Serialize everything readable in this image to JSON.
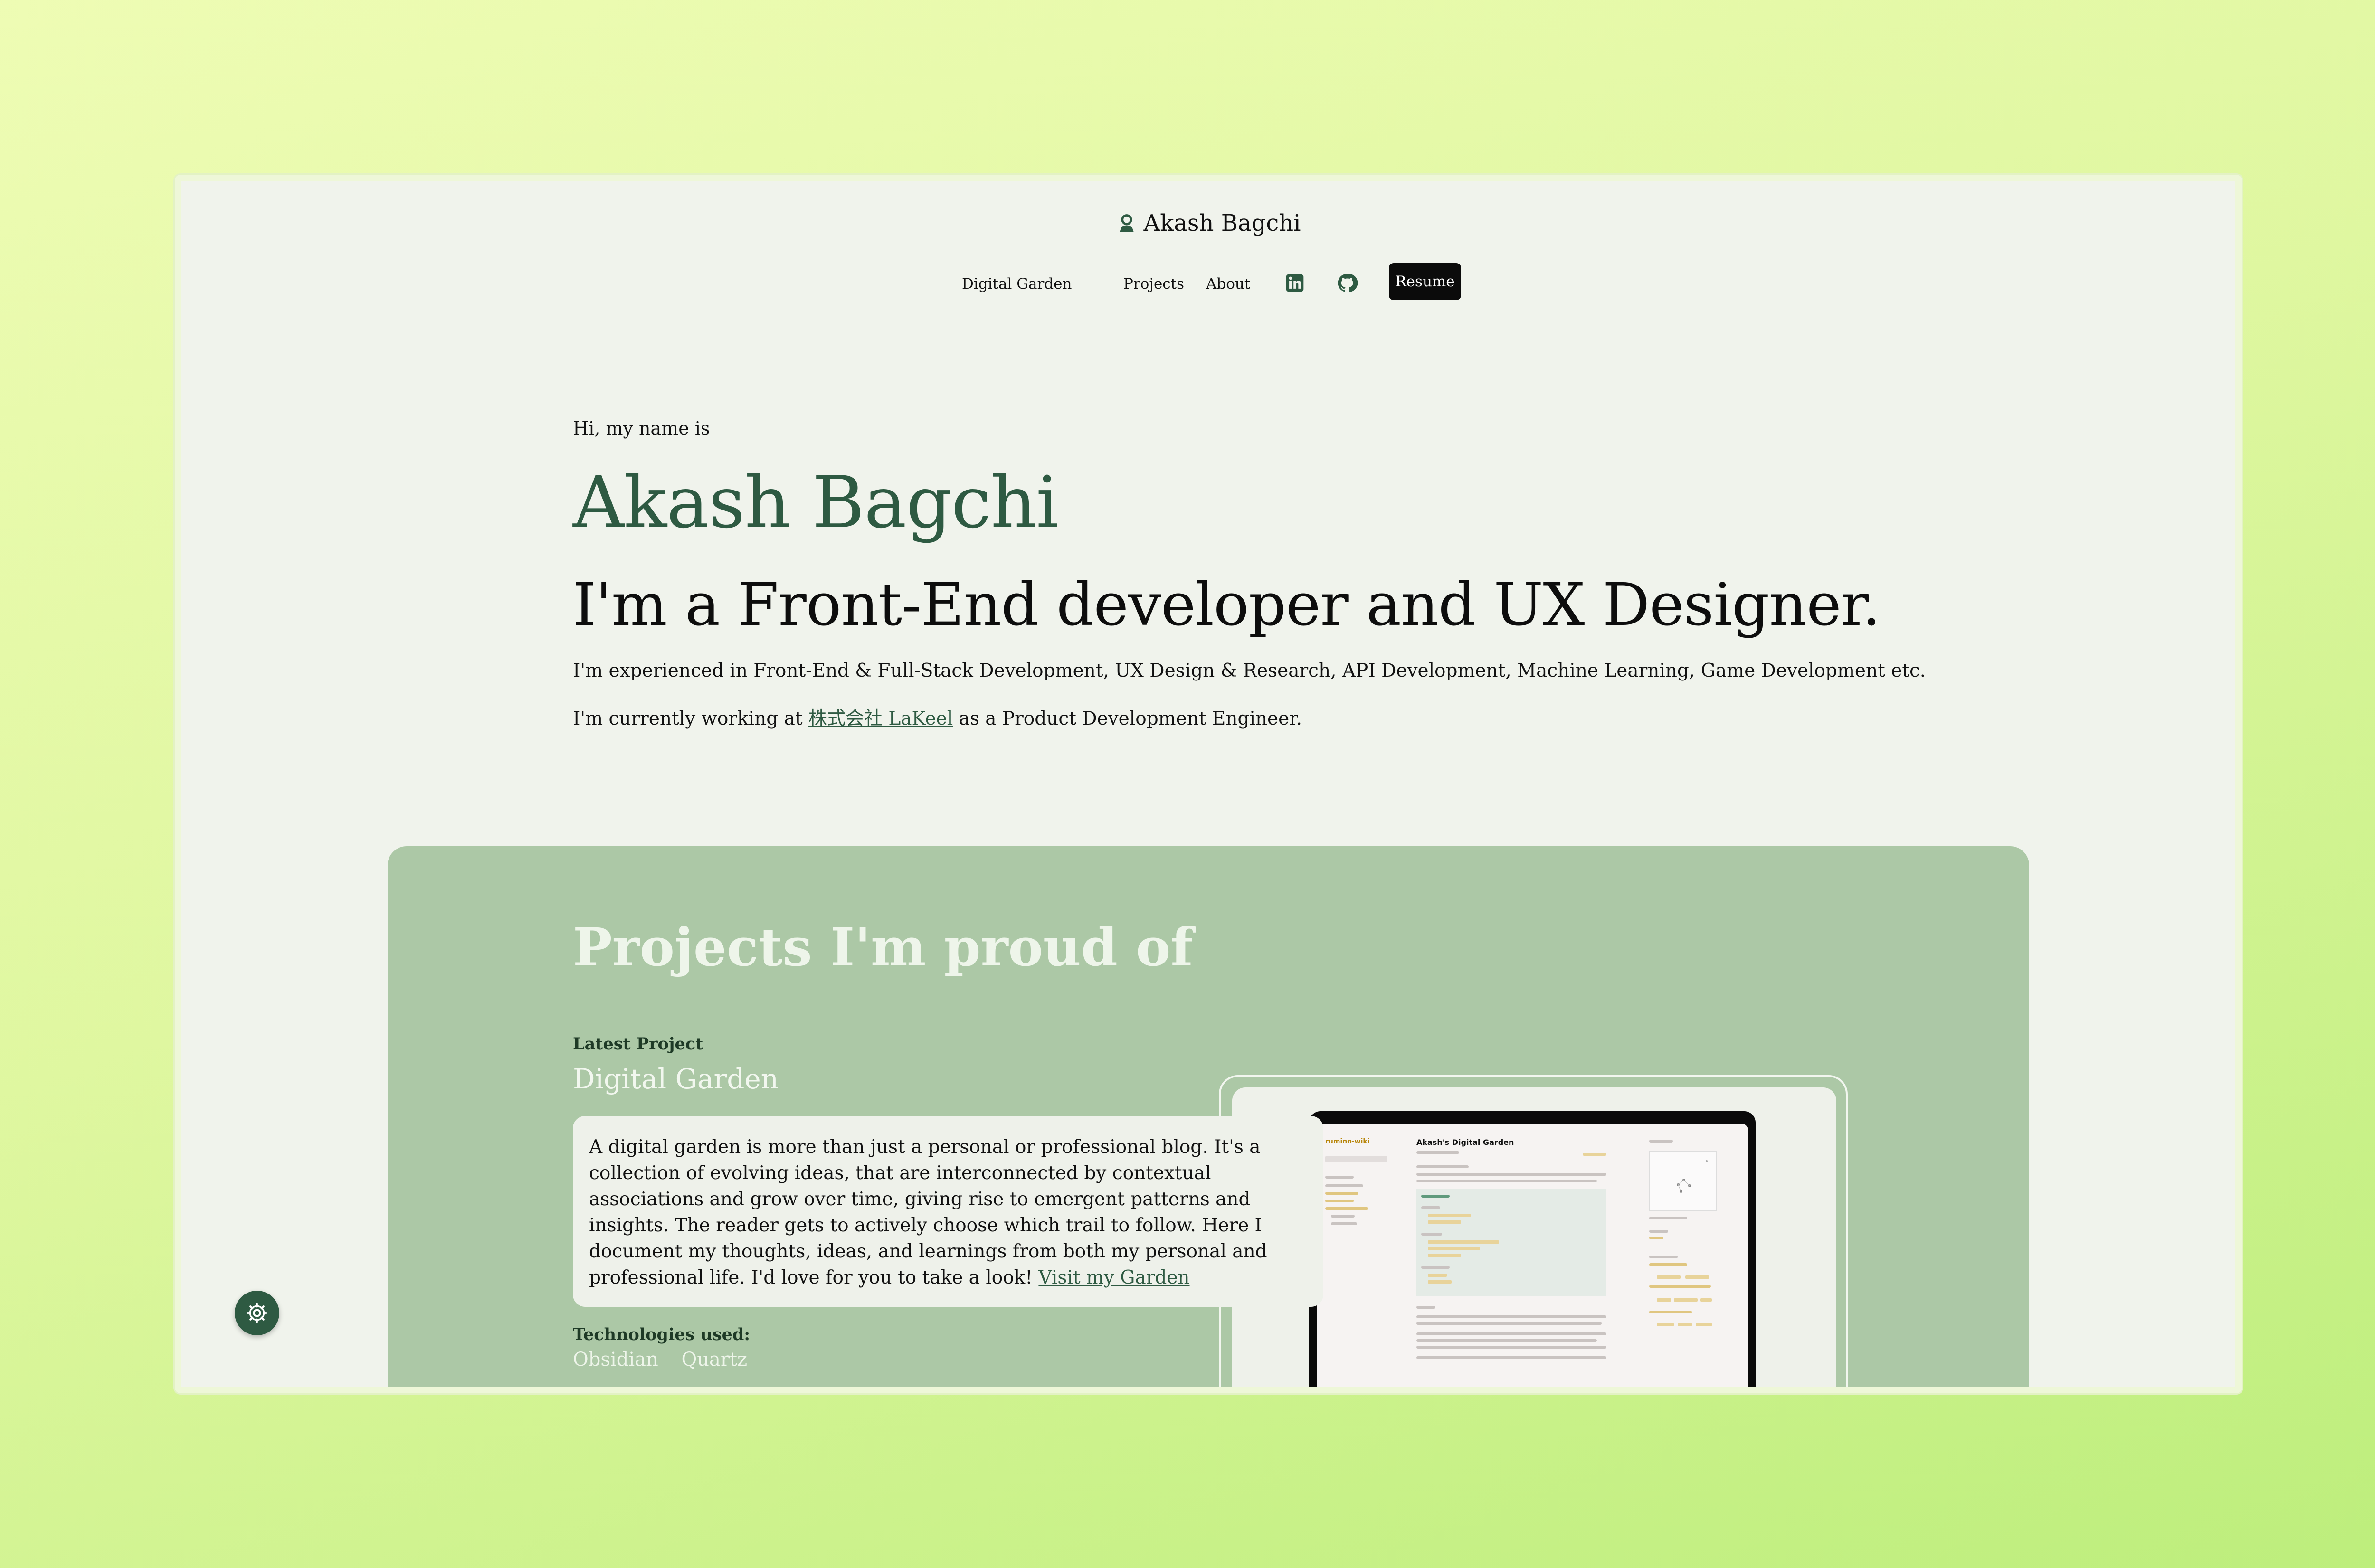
{
  "header": {
    "brand_name": "Akash Bagchi",
    "brand_icon": "person-icon"
  },
  "nav": {
    "items": [
      {
        "label": "Digital Garden"
      },
      {
        "label": "Projects"
      },
      {
        "label": "About"
      }
    ],
    "linkedin_icon": "linkedin-icon",
    "github_icon": "github-icon",
    "resume_label": "Resume"
  },
  "hero": {
    "greeting": "Hi, my name is",
    "name": "Akash Bagchi",
    "headline": "I'm a Front-End developer and UX Designer.",
    "experience": "I'm experienced in Front-End & Full-Stack Development, UX Design & Research, API Development, Machine Learning, Game Development etc.",
    "work_prefix": "I'm currently working at ",
    "company": "株式会社 LaKeel",
    "work_suffix": " as a Product Development Engineer."
  },
  "projects": {
    "section_title": "Projects I'm proud of",
    "latest_label": "Latest Project",
    "project_name": "Digital Garden",
    "description": "A digital garden is more than just a personal or professional blog. It's a collection of evolving ideas, that are interconnected by contextual associations and grow over time, giving rise to emergent patterns and insights. The reader gets to actively choose which trail to follow. Here I document my thoughts, ideas, and learnings from both my personal and professional life. I'd love for you to take a look! ",
    "visit_link": "Visit my Garden",
    "tech_label": "Technologies used:",
    "technologies": [
      "Obsidian",
      "Quartz"
    ],
    "preview": {
      "site_name": "rumino-wiki",
      "page_title": "Akash's Digital Garden"
    }
  },
  "settings_button_icon": "gear-icon",
  "colors": {
    "accent": "#2e5a42",
    "section_bg": "#acc8a6",
    "page_bg": "#f0f3ec"
  }
}
